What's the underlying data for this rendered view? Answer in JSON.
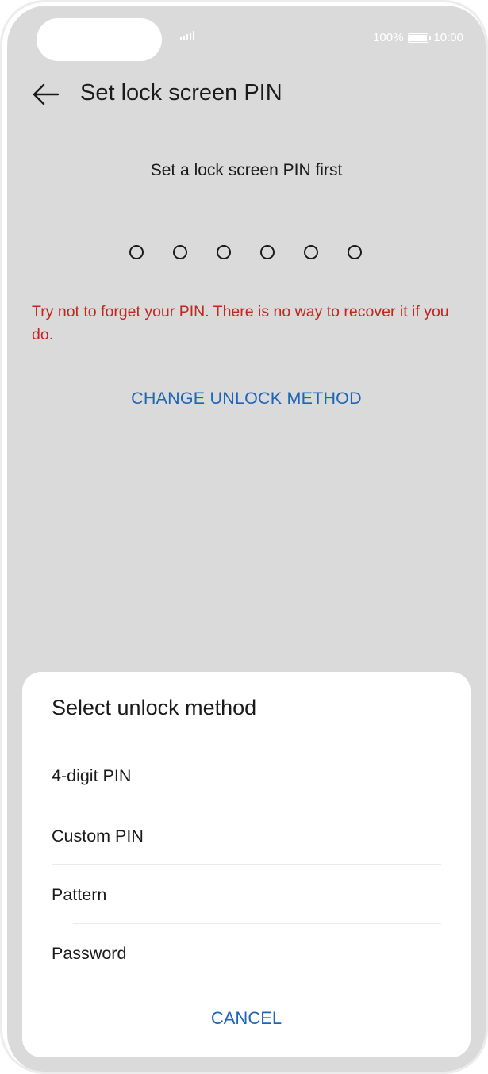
{
  "status_bar": {
    "battery_text": "100%",
    "battery_level": 1.0,
    "time": "10:00",
    "signal_icon": "signal-icon",
    "battery_icon": "battery-icon"
  },
  "header": {
    "back_icon": "arrow-left-icon",
    "title": "Set lock screen PIN"
  },
  "main": {
    "prompt": "Set a lock screen PIN first",
    "pin_length": 6,
    "warning": "Try not to forget your PIN. There is no way to recover it if you do.",
    "change_method_label": "CHANGE UNLOCK METHOD"
  },
  "sheet": {
    "title": "Select unlock method",
    "options": [
      {
        "label": "4-digit PIN"
      },
      {
        "label": "Custom PIN"
      },
      {
        "label": "Pattern"
      },
      {
        "label": "Password"
      }
    ],
    "cancel_label": "CANCEL"
  },
  "colors": {
    "background": "#dadada",
    "warning": "#c0271e",
    "accent": "#1e64b8"
  }
}
